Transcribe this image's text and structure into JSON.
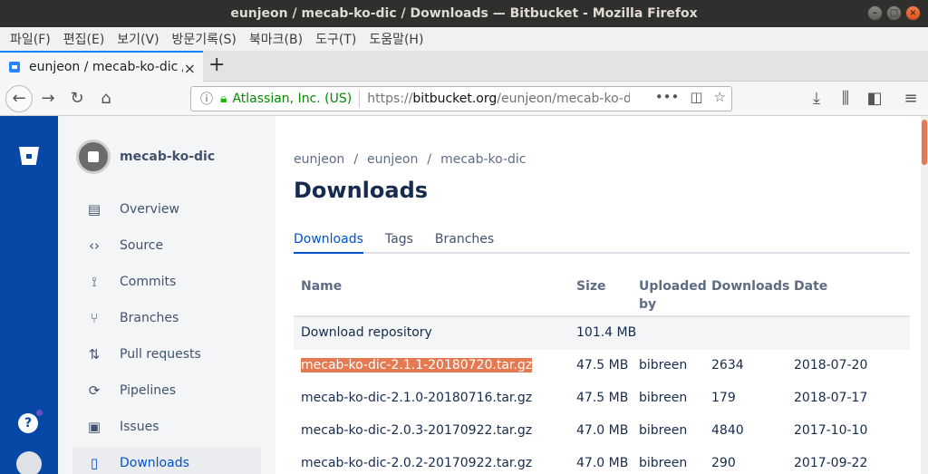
{
  "window": {
    "title": "eunjeon / mecab-ko-dic / Downloads — Bitbucket - Mozilla Firefox"
  },
  "menubar": [
    "파일(F)",
    "편집(E)",
    "보기(V)",
    "방문기록(S)",
    "북마크(B)",
    "도구(T)",
    "도움말(H)"
  ],
  "tab": {
    "title": "eunjeon / mecab-ko-dic / "
  },
  "urlbar": {
    "cert": "Atlassian, Inc. (US)",
    "url_prefix": "https://",
    "url_host": "bitbucket.org",
    "url_path": "/eunjeon/mecab-ko-di"
  },
  "sidebar": {
    "repo_name": "mecab-ko-dic",
    "items": [
      {
        "label": "Overview",
        "icon": "overview-icon"
      },
      {
        "label": "Source",
        "icon": "code-icon"
      },
      {
        "label": "Commits",
        "icon": "commit-icon"
      },
      {
        "label": "Branches",
        "icon": "branch-icon"
      },
      {
        "label": "Pull requests",
        "icon": "pull-request-icon"
      },
      {
        "label": "Pipelines",
        "icon": "pipelines-icon"
      },
      {
        "label": "Issues",
        "icon": "issues-icon"
      },
      {
        "label": "Downloads",
        "icon": "file-icon"
      }
    ]
  },
  "breadcrumb": [
    "eunjeon",
    "eunjeon",
    "mecab-ko-dic"
  ],
  "page_title": "Downloads",
  "tabs": [
    "Downloads",
    "Tags",
    "Branches"
  ],
  "table": {
    "headers": {
      "name": "Name",
      "size": "Size",
      "by": "Uploaded by",
      "downloads": "Downloads",
      "date": "Date"
    },
    "repo_row": {
      "name": "Download repository",
      "size": "101.4 MB"
    },
    "rows": [
      {
        "name": "mecab-ko-dic-2.1.1-20180720.tar.gz",
        "size": "47.5 MB",
        "by": "bibreen",
        "downloads": "2634",
        "date": "2018-07-20"
      },
      {
        "name": "mecab-ko-dic-2.1.0-20180716.tar.gz",
        "size": "47.5 MB",
        "by": "bibreen",
        "downloads": "179",
        "date": "2018-07-17"
      },
      {
        "name": "mecab-ko-dic-2.0.3-20170922.tar.gz",
        "size": "47.0 MB",
        "by": "bibreen",
        "downloads": "4840",
        "date": "2017-10-10"
      },
      {
        "name": "mecab-ko-dic-2.0.2-20170922.tar.gz",
        "size": "47.0 MB",
        "by": "bibreen",
        "downloads": "290",
        "date": "2017-09-22"
      }
    ]
  },
  "colors": {
    "accent": "#0052cc",
    "global_nav": "#0747a6",
    "highlight": "#e37a52"
  }
}
